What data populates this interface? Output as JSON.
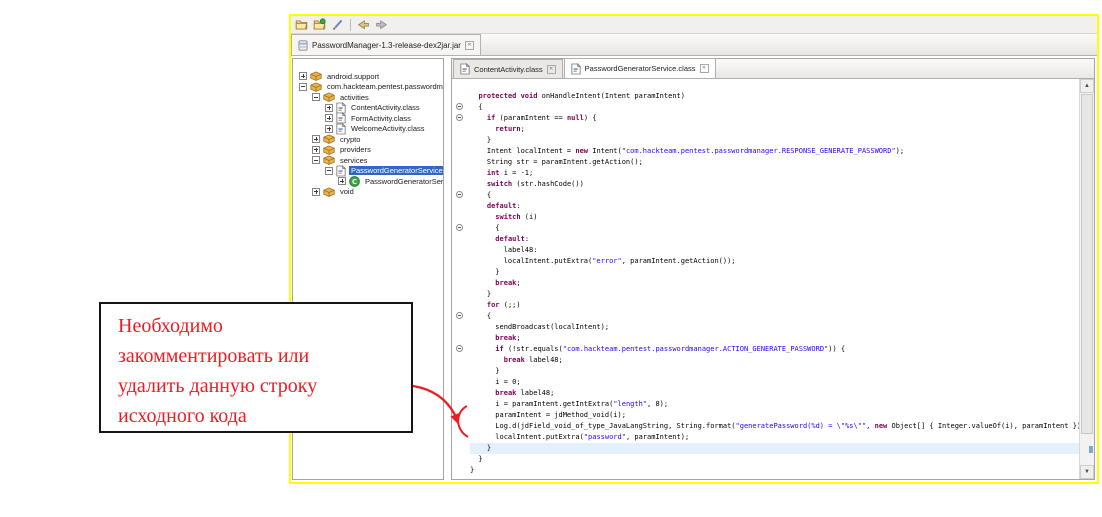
{
  "window": {
    "toolbar": {
      "items": [
        "open-file",
        "open-type",
        "search",
        "separator",
        "back",
        "forward"
      ]
    },
    "jar_tab": {
      "label": "PasswordManager-1.3-release-dex2jar.jar"
    },
    "tree": {
      "items": [
        {
          "level": 0,
          "expander": "+",
          "icon": "package",
          "label": "android.support"
        },
        {
          "level": 0,
          "expander": "-",
          "icon": "package",
          "label": "com.hackteam.pentest.passwordmanager"
        },
        {
          "level": 1,
          "expander": "-",
          "icon": "package",
          "label": "activities"
        },
        {
          "level": 2,
          "expander": "+",
          "icon": "classfile",
          "label": "ContentActivity.class"
        },
        {
          "level": 2,
          "expander": "+",
          "icon": "classfile",
          "label": "FormActivity.class"
        },
        {
          "level": 2,
          "expander": "+",
          "icon": "classfile",
          "label": "WelcomeActivity.class"
        },
        {
          "level": 1,
          "expander": "+",
          "icon": "package",
          "label": "crypto"
        },
        {
          "level": 1,
          "expander": "+",
          "icon": "package",
          "label": "providers"
        },
        {
          "level": 1,
          "expander": "-",
          "icon": "package",
          "label": "services"
        },
        {
          "level": 2,
          "expander": "-",
          "icon": "classfile",
          "label": "PasswordGeneratorService.class",
          "selected": true
        },
        {
          "level": 3,
          "expander": "+",
          "icon": "class",
          "label": "PasswordGeneratorService"
        },
        {
          "level": 1,
          "expander": "+",
          "icon": "package",
          "label": "void"
        }
      ]
    },
    "editor": {
      "tabs": [
        {
          "label": "ContentActivity.class",
          "active": false
        },
        {
          "label": "PasswordGeneratorService.class",
          "active": true
        }
      ],
      "code": {
        "fold_lines": [
          1,
          2,
          9,
          12,
          20,
          23
        ],
        "highlighted_line": 32,
        "lines": [
          [
            [
              "p",
              "  "
            ],
            [
              "k",
              "protected"
            ],
            [
              "p",
              " "
            ],
            [
              "k",
              "void"
            ],
            [
              "p",
              " onHandleIntent(Intent paramIntent)"
            ]
          ],
          [
            [
              "p",
              "  {"
            ]
          ],
          [
            [
              "p",
              "    "
            ],
            [
              "k",
              "if"
            ],
            [
              "p",
              " (paramIntent == "
            ],
            [
              "k",
              "null"
            ],
            [
              "p",
              ") {"
            ]
          ],
          [
            [
              "p",
              "      "
            ],
            [
              "k",
              "return"
            ],
            [
              "p",
              ";"
            ]
          ],
          [
            [
              "p",
              "    }"
            ]
          ],
          [
            [
              "p",
              "    Intent localIntent = "
            ],
            [
              "k",
              "new"
            ],
            [
              "p",
              " Intent("
            ],
            [
              "s",
              "\"com.hackteam.pentest.passwordmanager.RESPONSE_GENERATE_PASSWORD\""
            ],
            [
              "p",
              ");"
            ]
          ],
          [
            [
              "p",
              "    String str = paramIntent.getAction();"
            ]
          ],
          [
            [
              "p",
              "    "
            ],
            [
              "k",
              "int"
            ],
            [
              "p",
              " i = -1;"
            ]
          ],
          [
            [
              "p",
              "    "
            ],
            [
              "k",
              "switch"
            ],
            [
              "p",
              " (str.hashCode())"
            ]
          ],
          [
            [
              "p",
              "    {"
            ]
          ],
          [
            [
              "p",
              "    "
            ],
            [
              "k",
              "default"
            ],
            [
              "p",
              ": "
            ]
          ],
          [
            [
              "p",
              "      "
            ],
            [
              "k",
              "switch"
            ],
            [
              "p",
              " (i)"
            ]
          ],
          [
            [
              "p",
              "      {"
            ]
          ],
          [
            [
              "p",
              "      "
            ],
            [
              "k",
              "default"
            ],
            [
              "p",
              ": "
            ]
          ],
          [
            [
              "p",
              "        label48:"
            ]
          ],
          [
            [
              "p",
              "        localIntent.putExtra("
            ],
            [
              "s",
              "\"error\""
            ],
            [
              "p",
              ", paramIntent.getAction());"
            ]
          ],
          [
            [
              "p",
              "      }"
            ]
          ],
          [
            [
              "p",
              "      "
            ],
            [
              "k",
              "break"
            ],
            [
              "p",
              ";"
            ]
          ],
          [
            [
              "p",
              "    }"
            ]
          ],
          [
            [
              "p",
              "    "
            ],
            [
              "k",
              "for"
            ],
            [
              "p",
              " (;;)"
            ]
          ],
          [
            [
              "p",
              "    {"
            ]
          ],
          [
            [
              "p",
              "      sendBroadcast(localIntent);"
            ]
          ],
          [
            [
              "p",
              "      "
            ],
            [
              "k",
              "break"
            ],
            [
              "p",
              ";"
            ]
          ],
          [
            [
              "p",
              "      "
            ],
            [
              "k",
              "if"
            ],
            [
              "p",
              " (!str.equals("
            ],
            [
              "s",
              "\"com.hackteam.pentest.passwordmanager.ACTION_GENERATE_PASSWORD\""
            ],
            [
              "p",
              ")) {"
            ]
          ],
          [
            [
              "p",
              "        "
            ],
            [
              "k",
              "break"
            ],
            [
              "p",
              " label48;"
            ]
          ],
          [
            [
              "p",
              "      }"
            ]
          ],
          [
            [
              "p",
              "      i = 0;"
            ]
          ],
          [
            [
              "p",
              "      "
            ],
            [
              "k",
              "break"
            ],
            [
              "p",
              " label48;"
            ]
          ],
          [
            [
              "p",
              "      i = paramIntent.getIntExtra("
            ],
            [
              "s",
              "\"length\""
            ],
            [
              "p",
              ", 8);"
            ]
          ],
          [
            [
              "p",
              "      paramIntent = jdMethod_void(i);"
            ]
          ],
          [
            [
              "p",
              "      Log.d(jdField_void_of_type_JavaLangString, String.format("
            ],
            [
              "s",
              "\"generatePassword(%d) = \\\"%s\\\"\""
            ],
            [
              "p",
              ", "
            ],
            [
              "k",
              "new"
            ],
            [
              "p",
              " Object[] { Integer.valueOf(i), paramIntent }));"
            ]
          ],
          [
            [
              "p",
              "      localIntent.putExtra("
            ],
            [
              "s",
              "\"password\""
            ],
            [
              "p",
              ", paramIntent);"
            ]
          ],
          [
            [
              "p",
              "    }"
            ]
          ],
          [
            [
              "p",
              "  }"
            ]
          ],
          [
            [
              "p",
              "}"
            ]
          ]
        ]
      }
    }
  },
  "annotation": {
    "callout_lines": [
      "Необходимо",
      "закомментировать или",
      "удалить данную строку",
      "исходного кода"
    ]
  },
  "colors": {
    "window_border": "#FFFF00",
    "selection_blue": "#3166C4",
    "highlight_line": "#E4F0FB",
    "keyword": "#7B0052",
    "string": "#2A00FF",
    "annotation_red": "#ED1C24"
  }
}
